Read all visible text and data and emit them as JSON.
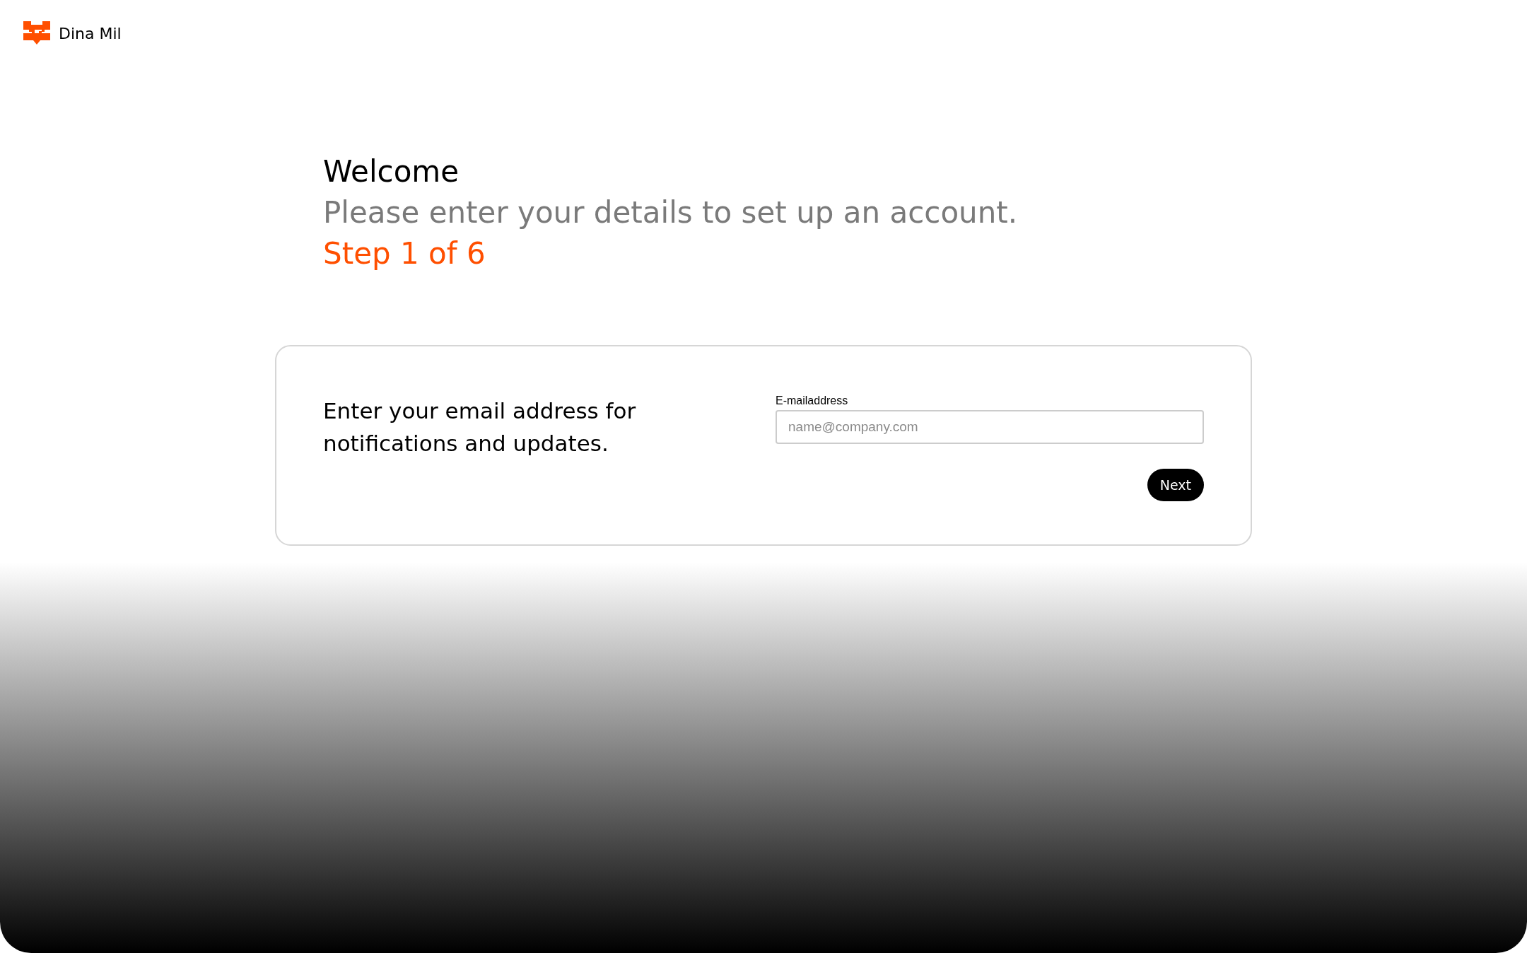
{
  "brand": {
    "name": "Dina Mil"
  },
  "header": {
    "title": "Welcome",
    "subtitle": "Please enter your details to set up an account.",
    "step": "Step 1 of 6"
  },
  "card": {
    "prompt": "Enter your email address for notifications and updates.",
    "field": {
      "label": "E-mailaddress",
      "placeholder": "name@company.com"
    },
    "button": "Next"
  }
}
